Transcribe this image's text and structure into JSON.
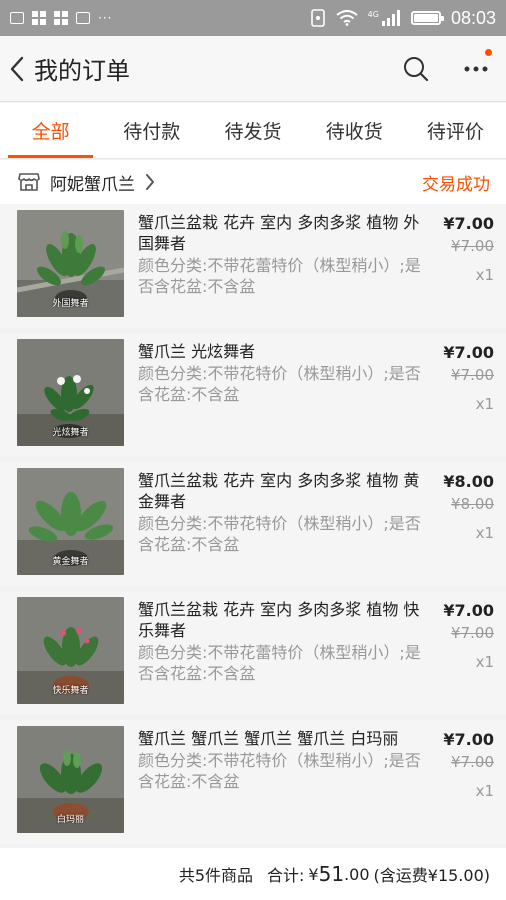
{
  "status_bar": {
    "dots": "···",
    "time": "08:03",
    "signal_label": "4G"
  },
  "nav": {
    "title": "我的订单"
  },
  "tabs": [
    {
      "label": "全部",
      "active": true
    },
    {
      "label": "待付款",
      "active": false
    },
    {
      "label": "待发货",
      "active": false
    },
    {
      "label": "待收货",
      "active": false
    },
    {
      "label": "待评价",
      "active": false
    }
  ],
  "shop": {
    "name": "阿妮蟹爪兰",
    "status": "交易成功"
  },
  "items": [
    {
      "title": "蟹爪兰盆栽 花卉 室内 多肉多浆 植物  外国舞者",
      "sku": "颜色分类:不带花蕾特价（株型稍小）;是否含花盆:不含盆",
      "price": "¥7.00",
      "orig_price": "¥7.00",
      "qty": "x1",
      "caption": "外国舞者"
    },
    {
      "title": "蟹爪兰  光炫舞者",
      "sku": "颜色分类:不带花特价（株型稍小）;是否含花盆:不含盆",
      "price": "¥7.00",
      "orig_price": "¥7.00",
      "qty": "x1",
      "caption": "光炫舞者"
    },
    {
      "title": "蟹爪兰盆栽 花卉 室内 多肉多浆 植物  黄金舞者",
      "sku": "颜色分类:不带花特价（株型稍小）;是否含花盆:不含盆",
      "price": "¥8.00",
      "orig_price": "¥8.00",
      "qty": "x1",
      "caption": "黄金舞者"
    },
    {
      "title": "蟹爪兰盆栽 花卉 室内 多肉多浆 植物  快乐舞者",
      "sku": "颜色分类:不带花蕾特价（株型稍小）;是否含花盆:不含盆",
      "price": "¥7.00",
      "orig_price": "¥7.00",
      "qty": "x1",
      "caption": "快乐舞者"
    },
    {
      "title": "蟹爪兰 蟹爪兰 蟹爪兰 蟹爪兰 白玛丽",
      "sku": "颜色分类:不带花特价（株型稍小）;是否含花盆:不含盆",
      "price": "¥7.00",
      "orig_price": "¥7.00",
      "qty": "x1",
      "caption": "白玛丽"
    }
  ],
  "summary": {
    "count_text": "共5件商品",
    "total_label": "合计:",
    "currency": "¥",
    "total_int": "51",
    "total_dec": ".00",
    "shipping": "(含运费¥15.00)"
  },
  "colors": {
    "accent": "#ff5000",
    "status_bar": "#9a9a9a"
  }
}
